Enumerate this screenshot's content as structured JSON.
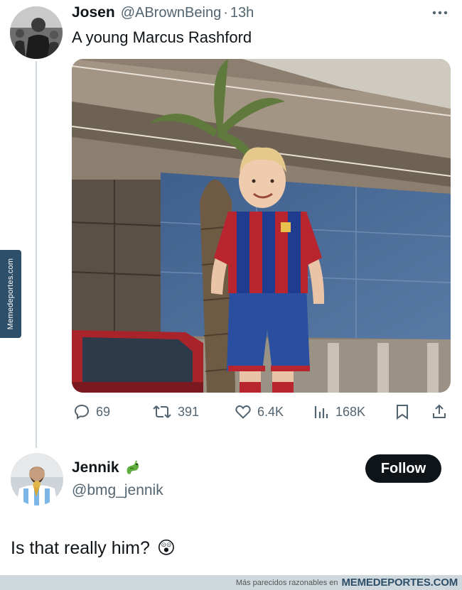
{
  "tweet": {
    "author_name": "Josen",
    "author_handle": "@ABrownBeing",
    "separator": "·",
    "time": "13h",
    "text": "A young Marcus Rashford",
    "media_icon": "photo",
    "actions": {
      "replies": "69",
      "retweets": "391",
      "likes": "6.4K",
      "views": "168K"
    }
  },
  "reply": {
    "author_name": "Jennik",
    "author_handle": "@bmg_jennik",
    "follow_label": "Follow",
    "text": "Is that really him?",
    "emoji": "😲",
    "badge_icon": "dragon-emoji"
  },
  "watermark": {
    "side_text": "Memedeportes.com",
    "footer_text": "Más parecidos razonables en",
    "footer_brand": "MEMEDEPORTES.COM"
  },
  "colors": {
    "text": "#0f1419",
    "secondary": "#536471",
    "thread_line": "#cfd9de",
    "watermark_bg": "#2e4f6a"
  }
}
